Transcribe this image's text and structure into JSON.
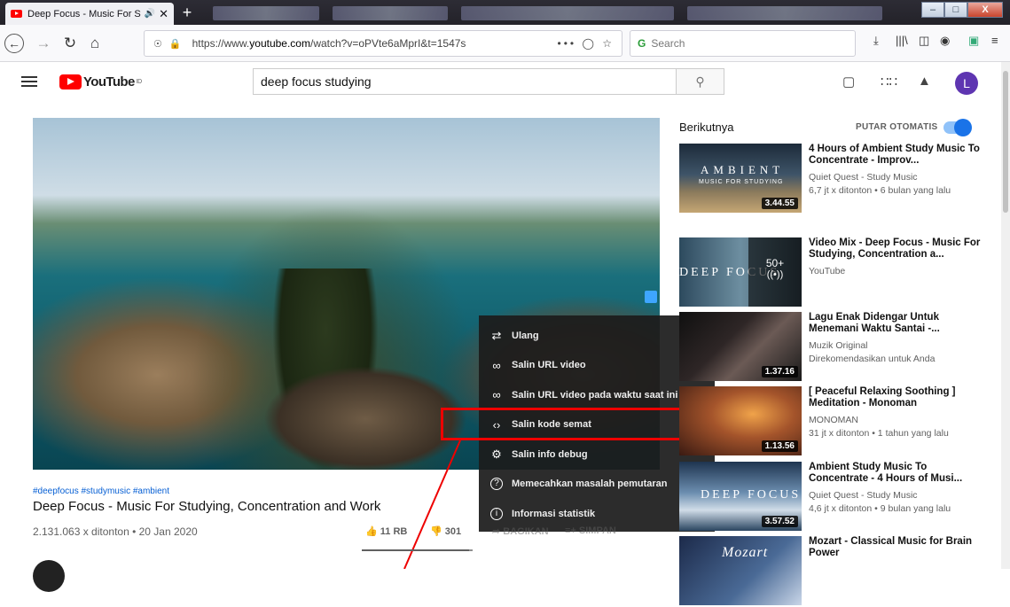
{
  "browser": {
    "tab_title": "Deep Focus - Music For Stu",
    "url_prefix": "https://www.",
    "url_domain": "youtube.com",
    "url_path": "/watch?v=oPVte6aMprI&t=1547s",
    "url_more": "•••",
    "search_placeholder": "Search",
    "accent_color": "#1c1b22"
  },
  "youtube": {
    "logo_text": "YouTube",
    "region": "ID",
    "search_query": "deep focus studying",
    "avatar_letter": "L"
  },
  "video": {
    "hashtags": "#deepfocus #studymusic #ambient",
    "title": "Deep Focus - Music For Studying, Concentration and Work",
    "views_date": "2.131.063 x ditonton • 20 Jan 2020",
    "likes": "11 RB",
    "dislikes": "301",
    "share": "BAGIKAN",
    "save": "SIMPAN",
    "like_ratio": 0.97
  },
  "context_menu": {
    "items": [
      {
        "icon": "loop-icon",
        "label": "Ulang"
      },
      {
        "icon": "link-icon",
        "label": "Salin URL video"
      },
      {
        "icon": "link-icon",
        "label": "Salin URL video pada waktu saat ini"
      },
      {
        "icon": "embed-code-icon",
        "label": "Salin kode semat"
      },
      {
        "icon": "debug-icon",
        "label": "Salin info debug"
      },
      {
        "icon": "help-icon",
        "label": "Memecahkan masalah pemutaran"
      },
      {
        "icon": "info-icon",
        "label": "Informasi statistik"
      }
    ],
    "highlighted_index": 3,
    "highlight_color": "#e00000"
  },
  "sidebar": {
    "header": "Berikutnya",
    "autoplay": "PUTAR OTOMATIS",
    "autoplay_on": true,
    "items": [
      {
        "title": "4 Hours of Ambient Study Music To Concentrate - Improv...",
        "channel": "Quiet Quest - Study Music",
        "meta": "6,7 jt x ditonton • 6 bulan yang lalu",
        "duration": "3.44.55",
        "overlay": "AMBIENT",
        "overlay_sub": "MUSIC FOR STUDYING"
      },
      {
        "title": "Video Mix - Deep Focus - Music For Studying, Concentration a...",
        "channel": "YouTube",
        "meta": "",
        "duration": "",
        "overlay": "DEEP FOCUS",
        "count": "50+"
      },
      {
        "title": "Lagu Enak Didengar Untuk Menemani Waktu Santai -...",
        "channel": "Muzik Original",
        "meta": "Direkomendasikan untuk Anda",
        "duration": "1.37.16"
      },
      {
        "title": "[ Peaceful Relaxing Soothing ] Meditation - Monoman",
        "channel": "MONOMAN",
        "meta": "31 jt x ditonton • 1 tahun yang lalu",
        "duration": "1.13.56"
      },
      {
        "title": "Ambient Study Music To Concentrate - 4 Hours of Musi...",
        "channel": "Quiet Quest - Study Music",
        "meta": "4,6 jt x ditonton • 9 bulan yang lalu",
        "duration": "3.57.52",
        "overlay": "DEEP FOCUS"
      },
      {
        "title": "Mozart - Classical Music for Brain Power",
        "channel": "",
        "meta": "",
        "duration": "",
        "overlay": "Mozart"
      }
    ]
  }
}
